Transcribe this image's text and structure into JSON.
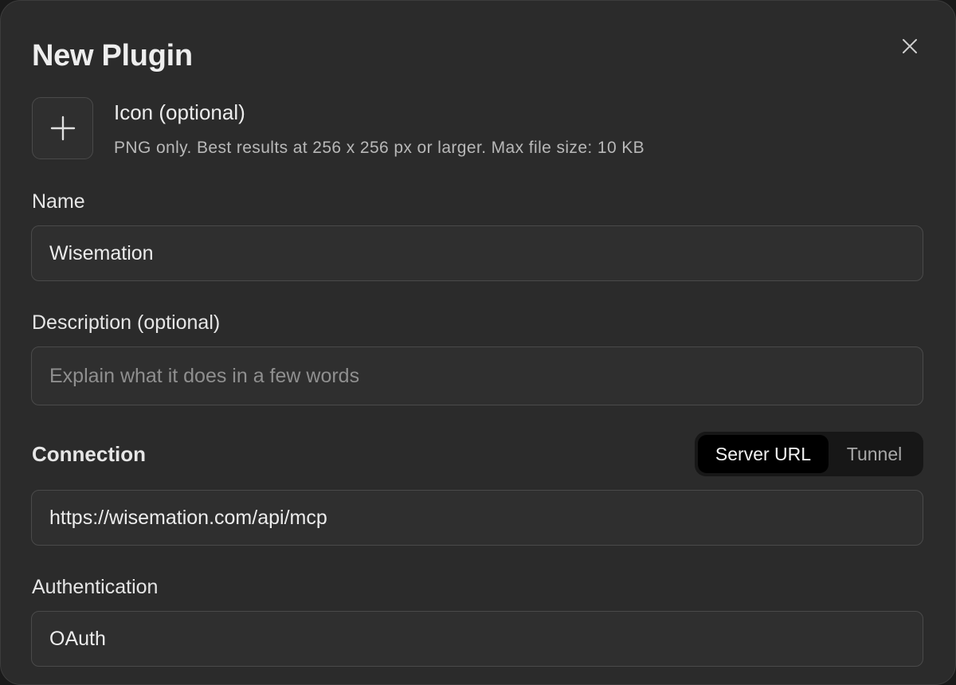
{
  "dialog": {
    "title": "New Plugin",
    "close_icon": "close-icon"
  },
  "icon_section": {
    "upload_icon": "plus-icon",
    "label": "Icon (optional)",
    "help": "PNG only. Best results at 256 x 256 px or larger. Max file size: 10 KB"
  },
  "name": {
    "label": "Name",
    "value": "Wisemation"
  },
  "description": {
    "label": "Description (optional)",
    "value": "",
    "placeholder": "Explain what it does in a few words"
  },
  "connection": {
    "label": "Connection",
    "options": [
      "Server URL",
      "Tunnel"
    ],
    "selected": "Server URL",
    "value": "https://wisemation.com/api/mcp"
  },
  "authentication": {
    "label": "Authentication",
    "value": "OAuth"
  }
}
